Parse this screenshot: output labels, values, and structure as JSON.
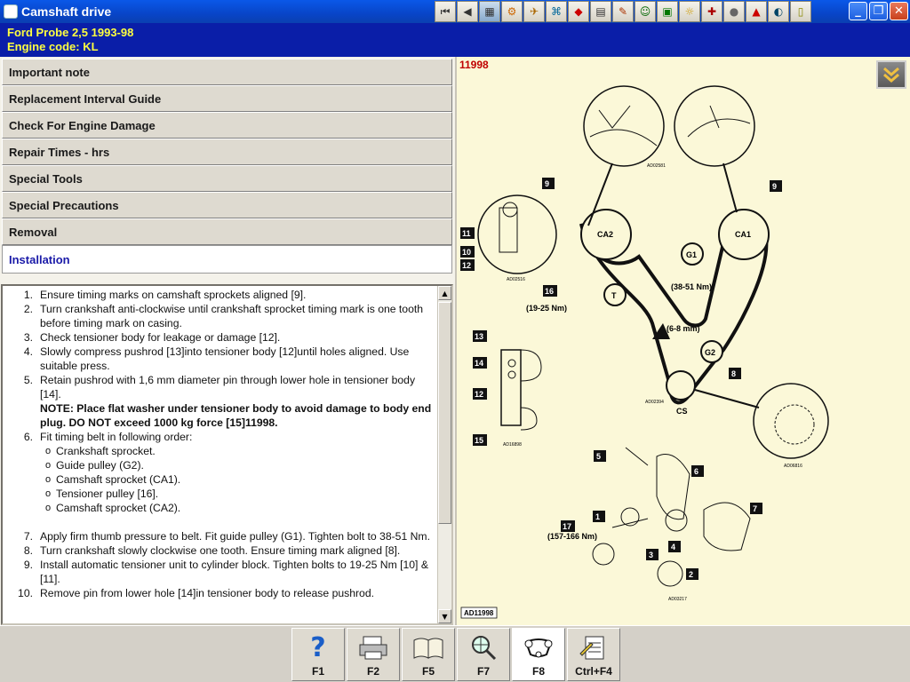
{
  "window": {
    "title": "Camshaft drive",
    "toolbar_icons": [
      "first-page-icon",
      "previous-icon",
      "diagram-icon",
      "engine-icon",
      "tools-icon",
      "wiring-icon",
      "vehicle-icon",
      "repair-icon",
      "pen-icon",
      "people-icon",
      "network-icon",
      "lamp-icon",
      "settings-icon",
      "wrench-icon",
      "warning-icon",
      "gauge-icon",
      "document-icon"
    ],
    "minimize_label": "_",
    "maximize_label": "❐",
    "close_label": "✕"
  },
  "vehicle": {
    "line1": "Ford   Probe 2,5   1993-98",
    "line2": "Engine code: KL"
  },
  "nav": {
    "items": [
      {
        "label": "Important note"
      },
      {
        "label": "Replacement Interval Guide"
      },
      {
        "label": "Check For Engine Damage"
      },
      {
        "label": "Repair Times - hrs"
      },
      {
        "label": "Special Tools"
      },
      {
        "label": "Special Precautions"
      },
      {
        "label": "Removal"
      },
      {
        "label": "Installation"
      }
    ],
    "active_index": 7
  },
  "instructions": {
    "steps": [
      {
        "num": "1.",
        "text": "Ensure timing marks on camshaft sprockets aligned [9]."
      },
      {
        "num": "2.",
        "text": "Turn crankshaft anti-clockwise until crankshaft sprocket timing mark is one tooth before timing mark on casing."
      },
      {
        "num": "3.",
        "text": "Check tensioner body for leakage or damage [12]."
      },
      {
        "num": "4.",
        "text": "Slowly compress pushrod [13]into tensioner body [12]until holes aligned. Use suitable press."
      },
      {
        "num": "5.",
        "text": "Retain pushrod with 1,6 mm diameter pin through lower hole in tensioner body [14].",
        "note": "NOTE: Place flat washer under tensioner body to avoid damage to body end plug. DO NOT exceed 1000 kg force [15]11998."
      },
      {
        "num": "6.",
        "text": "Fit timing belt in following order:"
      },
      {
        "num": "7.",
        "text": "Apply firm thumb pressure to belt. Fit guide pulley (G1). Tighten bolt to 38-51 Nm."
      },
      {
        "num": "8.",
        "text": "Turn crankshaft slowly clockwise one tooth. Ensure timing mark aligned [8]."
      },
      {
        "num": "9.",
        "text": "Install automatic tensioner unit to cylinder block. Tighten bolts to 19-25 Nm [10] & [11]."
      },
      {
        "num": "10.",
        "text": "Remove pin from lower hole [14]in tensioner body to release pushrod."
      }
    ],
    "sub_bullets": [
      "Crankshaft sprocket.",
      "Guide pulley (G2).",
      "Camshaft sprocket (CA1).",
      "Tensioner pulley [16].",
      "Camshaft sprocket (CA2)."
    ],
    "bullet_symbol": "o"
  },
  "diagram": {
    "id_label": "11998",
    "footer_label": "AD11998",
    "sprocket_labels": {
      "ca2": "CA2",
      "ca1": "CA1",
      "g1": "G1",
      "g2": "G2",
      "t": "T",
      "cs": "CS"
    },
    "torque_labels": {
      "g1": "(38-51 Nm)",
      "t": "(19-25 Nm)",
      "g2": "(6-8 mm)",
      "bottom": "(157-166 Nm)"
    },
    "callouts": [
      "9",
      "9",
      "11",
      "10",
      "12",
      "16",
      "13",
      "14",
      "12",
      "15",
      "8",
      "5",
      "6",
      "7",
      "1",
      "17",
      "3",
      "4",
      "2"
    ],
    "small_refs": [
      "AD02581",
      "AD02516",
      "AD02394",
      "AD06816",
      "AD16898",
      "AD03217"
    ]
  },
  "fkeys": [
    {
      "label": "F1",
      "icon": "help-icon"
    },
    {
      "label": "F2",
      "icon": "printer-icon"
    },
    {
      "label": "F5",
      "icon": "book-icon"
    },
    {
      "label": "F7",
      "icon": "magnifier-icon"
    },
    {
      "label": "F8",
      "icon": "timing-belt-icon"
    },
    {
      "label": "Ctrl+F4",
      "icon": "notepad-icon"
    }
  ],
  "colors": {
    "title_bar": "#0845c8",
    "vehicle_bg": "#0a1ea8",
    "vehicle_text": "#ffff40",
    "diagram_bg": "#fbf8d8",
    "diagram_id": "#c00000",
    "active_nav_text": "#1a1aa8"
  }
}
